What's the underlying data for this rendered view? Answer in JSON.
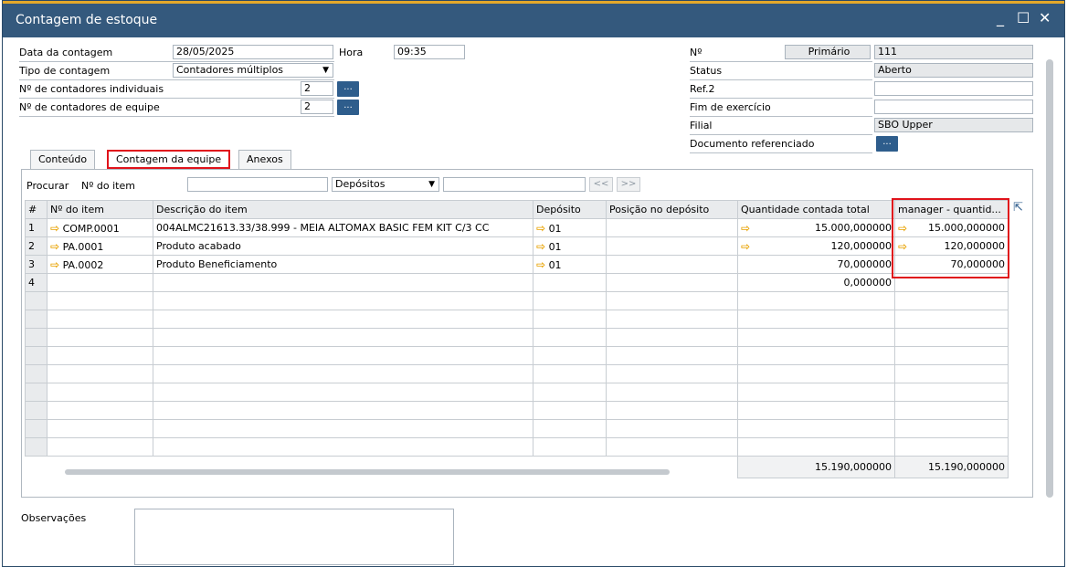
{
  "window": {
    "title": "Contagem de estoque",
    "minimize": "_",
    "maximize": "☐",
    "close": "✕"
  },
  "header_left": {
    "date_label": "Data da contagem",
    "date_value": "28/05/2025",
    "time_label": "Hora",
    "time_value": "09:35",
    "type_label": "Tipo de contagem",
    "type_value": "Contadores múltiplos",
    "individual_label": "Nº de contadores individuais",
    "individual_value": "2",
    "team_label": "Nº de contadores de equipe",
    "team_value": "2",
    "dots": "..."
  },
  "header_right": {
    "no_label": "Nº",
    "series_value": "Primário",
    "no_value": "111",
    "status_label": "Status",
    "status_value": "Aberto",
    "ref2_label": "Ref.2",
    "ref2_value": "",
    "fiscal_label": "Fim de exercício",
    "fiscal_value": "",
    "branch_label": "Filial",
    "branch_value": "SBO Upper",
    "refdoc_label": "Documento referenciado",
    "dots": "..."
  },
  "tabs": [
    {
      "label": "Conteúdo"
    },
    {
      "label": "Contagem da equipe"
    },
    {
      "label": "Anexos"
    }
  ],
  "search": {
    "label": "Procurar",
    "field_label": "Nº do item",
    "field_value": "",
    "warehouse_value": "Depósitos",
    "text_value": "",
    "prev": "<<",
    "next": ">>"
  },
  "grid": {
    "columns": [
      "#",
      "Nº do item",
      "Descrição do item",
      "Depósito",
      "Posição no depósito",
      "Quantidade contada total",
      "manager - quantid..."
    ],
    "rows": [
      {
        "n": "1",
        "item": "COMP.0001",
        "desc": "004ALMC21613.33/38.999 - MEIA ALTOMAX BASIC FEM KIT C/3 CC",
        "wh": "01",
        "pos": "",
        "total": "15.000,000000",
        "manager": "15.000,000000"
      },
      {
        "n": "2",
        "item": "PA.0001",
        "desc": "Produto acabado",
        "wh": "01",
        "pos": "",
        "total": "120,000000",
        "manager": "120,000000"
      },
      {
        "n": "3",
        "item": "PA.0002",
        "desc": "Produto Beneficiamento",
        "wh": "01",
        "pos": "",
        "total": "70,000000",
        "manager": "70,000000"
      },
      {
        "n": "4",
        "item": "",
        "desc": "",
        "wh": "",
        "pos": "",
        "total": "0,000000",
        "manager": ""
      }
    ],
    "totals": {
      "total": "15.190,000000",
      "manager": "15.190,000000"
    }
  },
  "remarks": {
    "label": "Observações",
    "value": ""
  },
  "colors": {
    "titlebar": "#34597d",
    "accent": "#e4a82a",
    "highlight": "#e0131b",
    "button": "#2e5d8c"
  },
  "icons": {
    "link_arrow": "arrow-right-icon",
    "dropdown": "chevron-down-icon",
    "expand": "expand-icon"
  }
}
